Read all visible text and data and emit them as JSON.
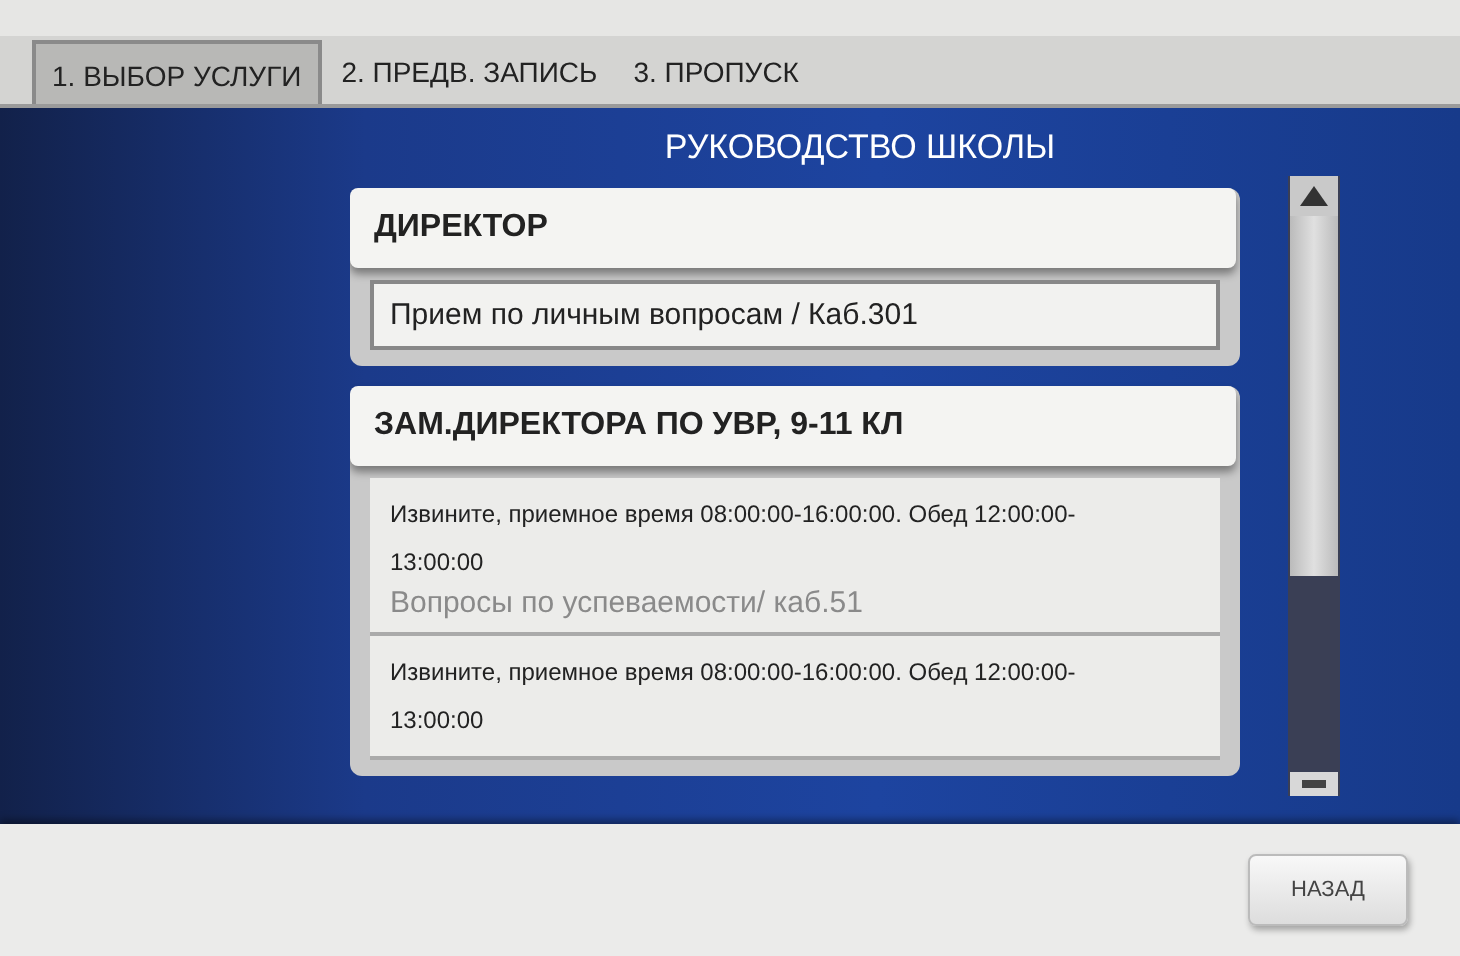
{
  "tabs": [
    {
      "label": "1. ВЫБОР УСЛУГИ",
      "selected": true
    },
    {
      "label": "2. ПРЕДВ. ЗАПИСЬ",
      "selected": false
    },
    {
      "label": "3. ПРОПУСК",
      "selected": false
    }
  ],
  "title": "РУКОВОДСТВО ШКОЛЫ",
  "groups": [
    {
      "header": "ДИРЕКТОР",
      "services": [
        {
          "name": "Прием по личным вопросам / Каб.301",
          "disabled": false
        }
      ]
    },
    {
      "header": "ЗАМ.ДИРЕКТОРА ПО УВР, 9-11 КЛ",
      "services": [
        {
          "notice": "Извините, приемное время 08:00:00-16:00:00. Обед 12:00:00-13:00:00",
          "name": "Вопросы по успеваемости/ каб.51",
          "disabled": true
        },
        {
          "notice": "Извините, приемное время 08:00:00-16:00:00. Обед 12:00:00-13:00:00"
        }
      ]
    }
  ],
  "back_button": "НАЗАД"
}
